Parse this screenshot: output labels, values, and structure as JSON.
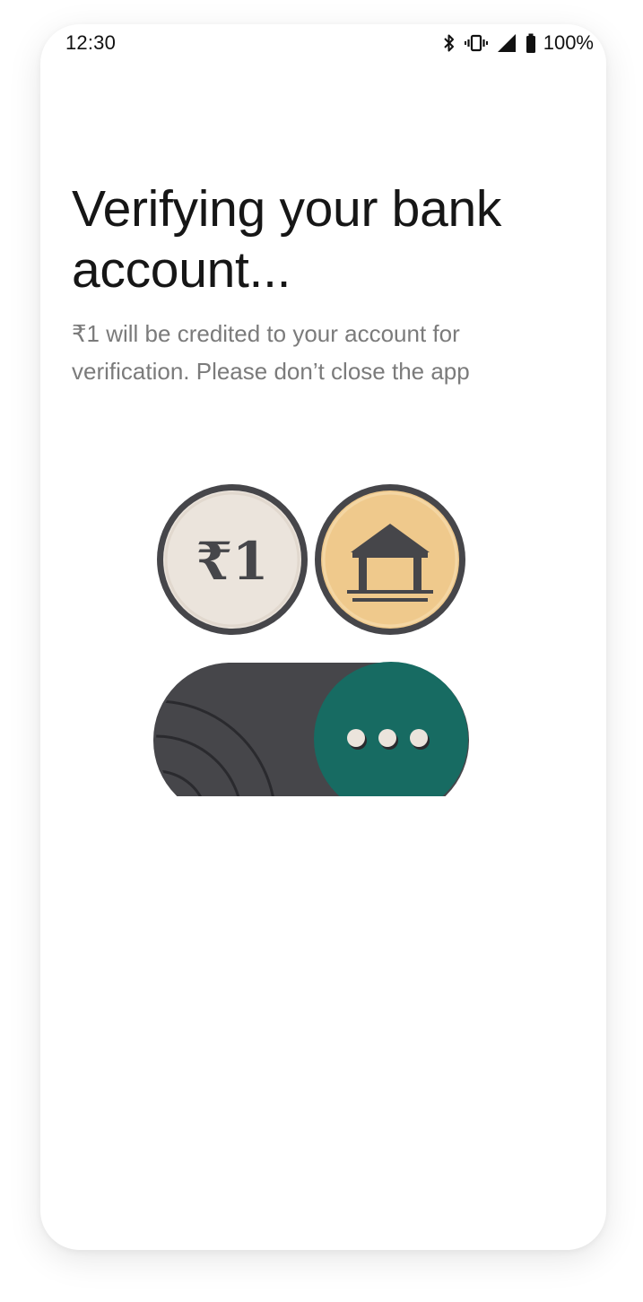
{
  "status_bar": {
    "time": "12:30",
    "battery_percent": "100%",
    "icons": [
      "bluetooth-icon",
      "vibrate-icon",
      "cell-signal-icon",
      "battery-icon"
    ]
  },
  "screen": {
    "title": "Verifying your bank account...",
    "subtitle": "₹1 will be credited to your account for verification. Please don’t close the app"
  },
  "illustration": {
    "rupee_label": "₹1",
    "icons": [
      "rupee-coin-icon",
      "bank-icon",
      "loading-dots-icon"
    ],
    "colors": {
      "dark": "#46464a",
      "coin_fill": "#ebe4dc",
      "bank_fill": "#efc98c",
      "teal": "#176b62",
      "dot": "#ebe4dc"
    }
  }
}
